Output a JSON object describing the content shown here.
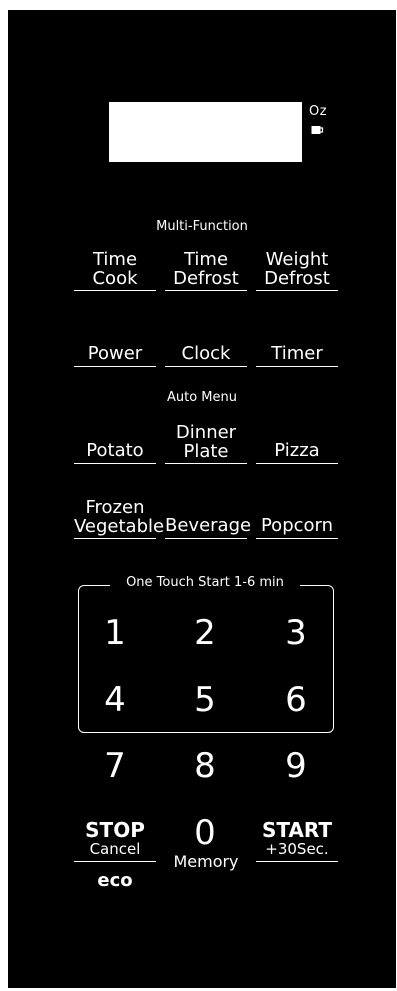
{
  "display": {
    "oz_label": "Oz",
    "cup_icon": "cup-icon"
  },
  "sections": {
    "multi_function": "Multi-Function",
    "auto_menu": "Auto Menu",
    "one_touch": "One Touch Start 1-6 min"
  },
  "buttons": {
    "time_cook": [
      "Time",
      "Cook"
    ],
    "time_defrost": [
      "Time",
      "Defrost"
    ],
    "weight_defrost": [
      "Weight",
      "Defrost"
    ],
    "power": "Power",
    "clock": "Clock",
    "timer": "Timer",
    "potato": "Potato",
    "dinner_plate": [
      "Dinner",
      "Plate"
    ],
    "pizza": "Pizza",
    "frozen_vegetable": [
      "Frozen",
      "Vegetable"
    ],
    "beverage": "Beverage",
    "popcorn": "Popcorn"
  },
  "numbers": [
    "1",
    "2",
    "3",
    "4",
    "5",
    "6",
    "7",
    "8",
    "9",
    "0"
  ],
  "bottom": {
    "stop": "STOP",
    "cancel": "Cancel",
    "eco": "eco",
    "memory": "Memory",
    "start": "START",
    "plus30": "+30Sec."
  }
}
